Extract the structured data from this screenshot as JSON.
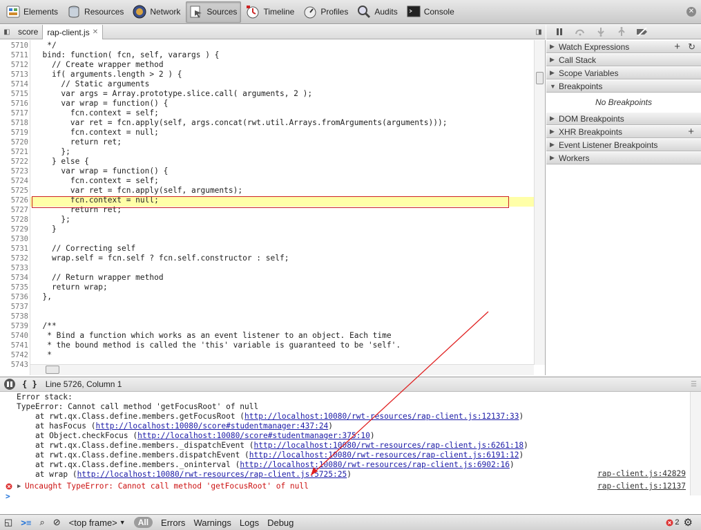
{
  "toolbar": {
    "panels": [
      {
        "label": "Elements",
        "icon": "elements-icon"
      },
      {
        "label": "Resources",
        "icon": "resources-icon"
      },
      {
        "label": "Network",
        "icon": "network-icon"
      },
      {
        "label": "Sources",
        "icon": "sources-icon",
        "active": true
      },
      {
        "label": "Timeline",
        "icon": "timeline-icon"
      },
      {
        "label": "Profiles",
        "icon": "profiles-icon"
      },
      {
        "label": "Audits",
        "icon": "audits-icon"
      },
      {
        "label": "Console",
        "icon": "console-icon"
      }
    ]
  },
  "tabs": {
    "score": "score",
    "file": "rap-client.js"
  },
  "editor": {
    "lines": [
      {
        "n": "5710",
        "t": "   */"
      },
      {
        "n": "5711",
        "t": "  bind: function( fcn, self, varargs ) {"
      },
      {
        "n": "5712",
        "t": "    // Create wrapper method"
      },
      {
        "n": "5713",
        "t": "    if( arguments.length > 2 ) {"
      },
      {
        "n": "5714",
        "t": "      // Static arguments"
      },
      {
        "n": "5715",
        "t": "      var args = Array.prototype.slice.call( arguments, 2 );"
      },
      {
        "n": "5716",
        "t": "      var wrap = function() {"
      },
      {
        "n": "5717",
        "t": "        fcn.context = self;"
      },
      {
        "n": "5718",
        "t": "        var ret = fcn.apply(self, args.concat(rwt.util.Arrays.fromArguments(arguments)));"
      },
      {
        "n": "5719",
        "t": "        fcn.context = null;"
      },
      {
        "n": "5720",
        "t": "        return ret;"
      },
      {
        "n": "5721",
        "t": "      };"
      },
      {
        "n": "5722",
        "t": "    } else {"
      },
      {
        "n": "5723",
        "t": "      var wrap = function() {"
      },
      {
        "n": "5724",
        "t": "        fcn.context = self;"
      },
      {
        "n": "5725",
        "t": "        var ret = fcn.apply(self, arguments);"
      },
      {
        "n": "5726",
        "t": "        fcn.context = null;"
      },
      {
        "n": "5727",
        "t": "        return ret;"
      },
      {
        "n": "5728",
        "t": "      };"
      },
      {
        "n": "5729",
        "t": "    }"
      },
      {
        "n": "5730",
        "t": ""
      },
      {
        "n": "5731",
        "t": "    // Correcting self"
      },
      {
        "n": "5732",
        "t": "    wrap.self = fcn.self ? fcn.self.constructor : self;"
      },
      {
        "n": "5733",
        "t": ""
      },
      {
        "n": "5734",
        "t": "    // Return wrapper method"
      },
      {
        "n": "5735",
        "t": "    return wrap;"
      },
      {
        "n": "5736",
        "t": "  },"
      },
      {
        "n": "5737",
        "t": ""
      },
      {
        "n": "5738",
        "t": ""
      },
      {
        "n": "5739",
        "t": "  /**"
      },
      {
        "n": "5740",
        "t": "   * Bind a function which works as an event listener to an object. Each time"
      },
      {
        "n": "5741",
        "t": "   * the bound method is called the 'this' variable is guaranteed to be 'self'."
      },
      {
        "n": "5742",
        "t": "   *"
      },
      {
        "n": "5743",
        "t": ""
      }
    ]
  },
  "sidebar": {
    "watch": "Watch Expressions",
    "callstack": "Call Stack",
    "scope": "Scope Variables",
    "breakpoints": "Breakpoints",
    "no_breakpoints": "No Breakpoints",
    "dom": "DOM Breakpoints",
    "xhr": "XHR Breakpoints",
    "listener": "Event Listener Breakpoints",
    "workers": "Workers"
  },
  "console_bar": {
    "cursor": "Line 5726, Column 1"
  },
  "console": {
    "lines": [
      {
        "pre": "Error stack:",
        "url": "",
        "post": ""
      },
      {
        "pre": "TypeError: Cannot call method 'getFocusRoot' of null",
        "url": "",
        "post": ""
      },
      {
        "pre": "    at rwt.qx.Class.define.members.getFocusRoot (",
        "url": "http://localhost:10080/rwt-resources/rap-client.js:12137:33",
        "post": ")"
      },
      {
        "pre": "    at hasFocus (",
        "url": "http://localhost:10080/score#studentmanager:437:24",
        "post": ")"
      },
      {
        "pre": "    at Object.checkFocus (",
        "url": "http://localhost:10080/score#studentmanager:375:10",
        "post": ")"
      },
      {
        "pre": "    at rwt.qx.Class.define.members._dispatchEvent (",
        "url": "http://localhost:10080/rwt-resources/rap-client.js:6261:18",
        "post": ")"
      },
      {
        "pre": "    at rwt.qx.Class.define.members.dispatchEvent (",
        "url": "http://localhost:10080/rwt-resources/rap-client.js:6191:12",
        "post": ")"
      },
      {
        "pre": "    at rwt.qx.Class.define.members._oninterval (",
        "url": "http://localhost:10080/rwt-resources/rap-client.js:6902:16",
        "post": ")"
      },
      {
        "pre": "    at wrap (",
        "url": "http://localhost:10080/rwt-resources/rap-client.js:5725:25",
        "post": ")"
      }
    ],
    "src1": "rap-client.js:42829",
    "uncaught": "Uncaught TypeError: Cannot call method 'getFocusRoot' of null",
    "src2": "rap-client.js:12137",
    "prompt": ">"
  },
  "status": {
    "frame": "<top frame>",
    "filter_all": "All",
    "errors": "Errors",
    "warnings": "Warnings",
    "logs": "Logs",
    "debug": "Debug",
    "error_count": "2"
  },
  "colors": {
    "highlight": "#ffffa8",
    "error": "#cc1111",
    "link": "#1a1aa6"
  }
}
